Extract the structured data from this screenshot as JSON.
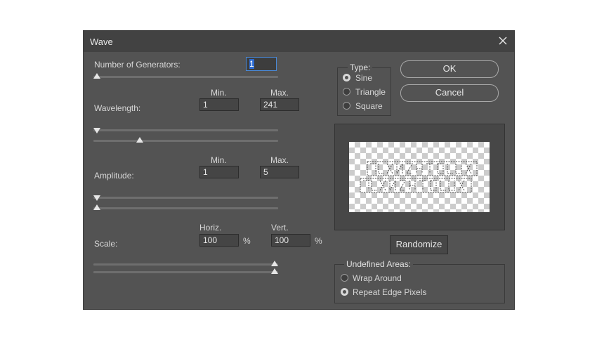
{
  "dialog": {
    "title": "Wave"
  },
  "generators": {
    "label": "Number of Generators:",
    "value": "1",
    "slider_fraction": 0.0
  },
  "wavelength": {
    "label": "Wavelength:",
    "min_header": "Min.",
    "max_header": "Max.",
    "min_value": "1",
    "max_value": "241",
    "min_slider_fraction": 0.0,
    "max_slider_fraction": 0.24
  },
  "amplitude": {
    "label": "Amplitude:",
    "min_header": "Min.",
    "max_header": "Max.",
    "min_value": "1",
    "max_value": "5",
    "min_slider_fraction": 0.0,
    "max_slider_fraction": 0.0
  },
  "scale": {
    "label": "Scale:",
    "horiz_header": "Horiz.",
    "vert_header": "Vert.",
    "horiz_value": "100",
    "vert_value": "100",
    "percent_symbol": "%",
    "horiz_slider_fraction": 1.0,
    "vert_slider_fraction": 1.0
  },
  "type_group": {
    "legend": "Type:",
    "options": [
      {
        "label": "Sine",
        "selected": true
      },
      {
        "label": "Triangle",
        "selected": false
      },
      {
        "label": "Square",
        "selected": false
      }
    ]
  },
  "buttons": {
    "ok": "OK",
    "cancel": "Cancel",
    "randomize": "Randomize"
  },
  "undefined_areas": {
    "legend": "Undefined Areas:",
    "options": [
      {
        "label": "Wrap Around",
        "selected": false
      },
      {
        "label": "Repeat Edge Pixels",
        "selected": true
      }
    ]
  },
  "icons": {
    "close": "close-icon",
    "slider_thumb_down": "triangle-down-icon",
    "slider_thumb_up": "triangle-up-icon"
  },
  "colors": {
    "dialog_bg": "#535353",
    "titlebar_bg": "#424242",
    "field_bg": "#454545",
    "focus": "#4a8ad8"
  }
}
